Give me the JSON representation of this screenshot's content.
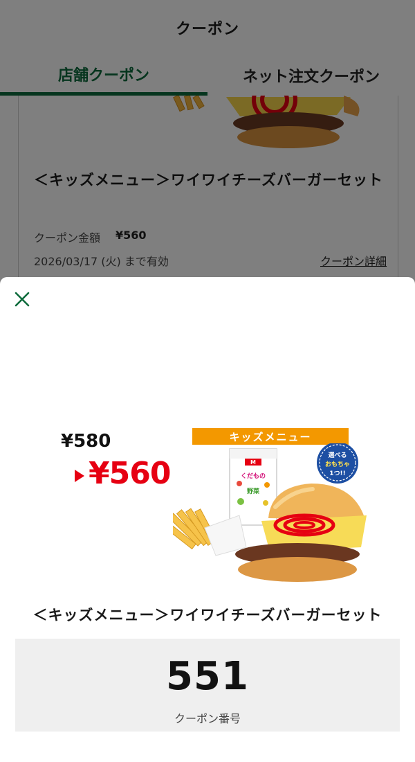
{
  "header": {
    "title": "クーポン"
  },
  "tabs": [
    {
      "label": "店舗クーポン",
      "active": true
    },
    {
      "label": "ネット注文クーポン",
      "active": false
    }
  ],
  "background_card": {
    "title": "＜キッズメニュー＞ワイワイチーズバーガーセット",
    "amount_label": "クーポン金額",
    "amount_value": "¥560",
    "valid_until": "2026/03/17 (火) まで有効",
    "detail_link": "クーポン詳細"
  },
  "sheet": {
    "close_icon": "close-icon",
    "visual": {
      "old_price": "¥580",
      "new_price": "¥560",
      "banner": "キッズメニュー",
      "badge_text": "選べる おもちゃ 1つ!!",
      "box_text": "くだもの 野菜"
    },
    "title": "＜キッズメニュー＞ワイワイチーズバーガーセット",
    "coupon_number": "551",
    "coupon_number_label": "クーポン番号"
  },
  "colors": {
    "brand_green": "#0d6b3c",
    "price_red": "#e60012",
    "banner_orange": "#f39800",
    "number_box_bg": "#efefef"
  }
}
